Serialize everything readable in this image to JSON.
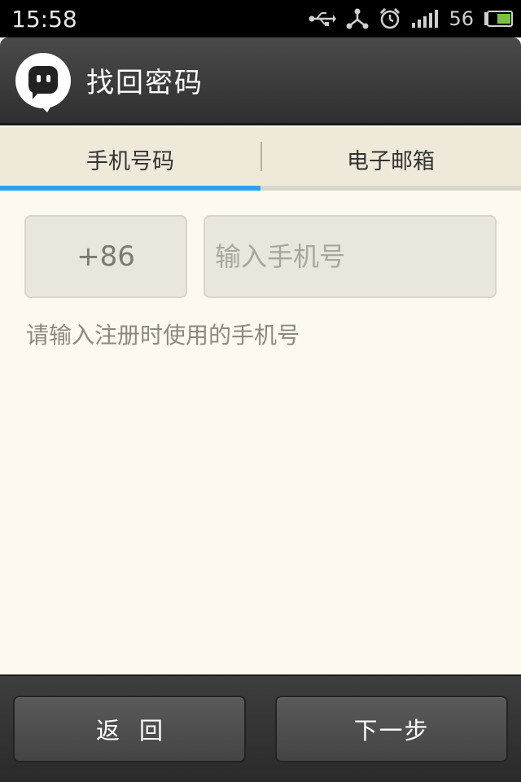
{
  "status_bar": {
    "time": "15:58",
    "battery_level": "56",
    "icons": [
      "usb-icon",
      "share-icon",
      "alarm-icon",
      "signal-icon",
      "battery-icon"
    ],
    "battery_color": "#7bc043"
  },
  "header": {
    "title": "找回密码",
    "logo_icon": "chat-bubble-logo-icon"
  },
  "tabs": [
    {
      "label": "手机号码",
      "active": true
    },
    {
      "label": "电子邮箱",
      "active": false
    }
  ],
  "form": {
    "country_code": "+86",
    "phone_placeholder": "输入手机号",
    "phone_value": "",
    "hint": "请输入注册时使用的手机号"
  },
  "footer": {
    "back_label": "返回",
    "next_label": "下一步"
  },
  "colors": {
    "accent": "#2ba2ec",
    "background": "#fdf9ee",
    "tab_background": "#efe9da"
  }
}
